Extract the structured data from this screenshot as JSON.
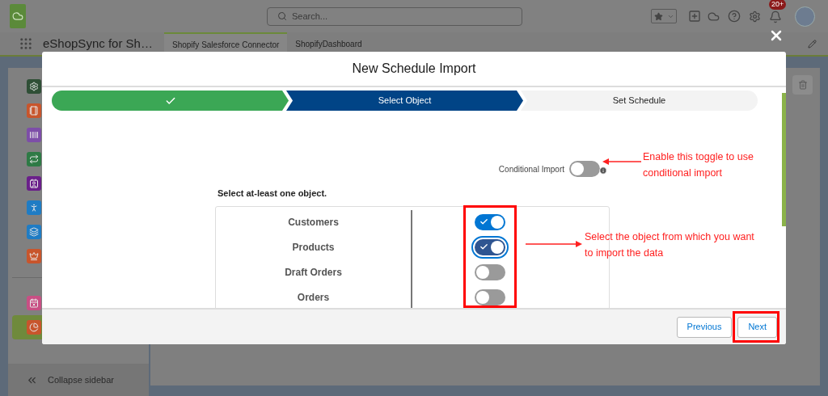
{
  "header": {
    "search": {
      "placeholder": "Search..."
    },
    "notification_badge": "20+"
  },
  "app_bar": {
    "app_name": "eShopSync for Sh…",
    "tabs": [
      {
        "label": "Shopify Salesforce Connector",
        "selected": true
      },
      {
        "label": "ShopifyDashboard",
        "selected": false
      }
    ]
  },
  "sidebar": {
    "items": [
      {
        "color": "#2f4f36",
        "selected": false
      },
      {
        "color": "#c8552c",
        "selected": false
      },
      {
        "color": "#7d4ea8",
        "selected": false
      },
      {
        "color": "#2e7a45",
        "selected": false
      },
      {
        "color": "#6a1f8a",
        "selected": false
      },
      {
        "color": "#1f7cc4",
        "selected": false
      },
      {
        "color": "#1f7cc4",
        "selected": false
      },
      {
        "color": "#c8552c",
        "selected": false
      }
    ],
    "bottom_items": [
      {
        "color": "#c84f84",
        "selected": false
      },
      {
        "color": "#c8552c",
        "selected": true
      }
    ],
    "collapse": "Collapse sidebar"
  },
  "modal": {
    "title": "New Schedule Import",
    "steps": [
      {
        "completed": true,
        "selected": false
      },
      {
        "label": "Select Object",
        "completed": false,
        "selected": true
      },
      {
        "label": "Set Schedule",
        "completed": false,
        "selected": false
      }
    ],
    "conditional_import": {
      "label": "Conditional Import",
      "on": false
    },
    "instruction": "Select at-least one object.",
    "objects": [
      {
        "name": "Customers",
        "on": true,
        "focused": false
      },
      {
        "name": "Products",
        "on": true,
        "focused": true
      },
      {
        "name": "Draft Orders",
        "on": false,
        "focused": false
      },
      {
        "name": "Orders",
        "on": false,
        "focused": false
      }
    ],
    "buttons": [
      {
        "label": "Previous"
      },
      {
        "label": "Next"
      }
    ]
  },
  "annotations": [
    {
      "text": "Enable this toggle to use\nconditional import"
    },
    {
      "text": "Select the object from which you want\nto import the data"
    }
  ]
}
